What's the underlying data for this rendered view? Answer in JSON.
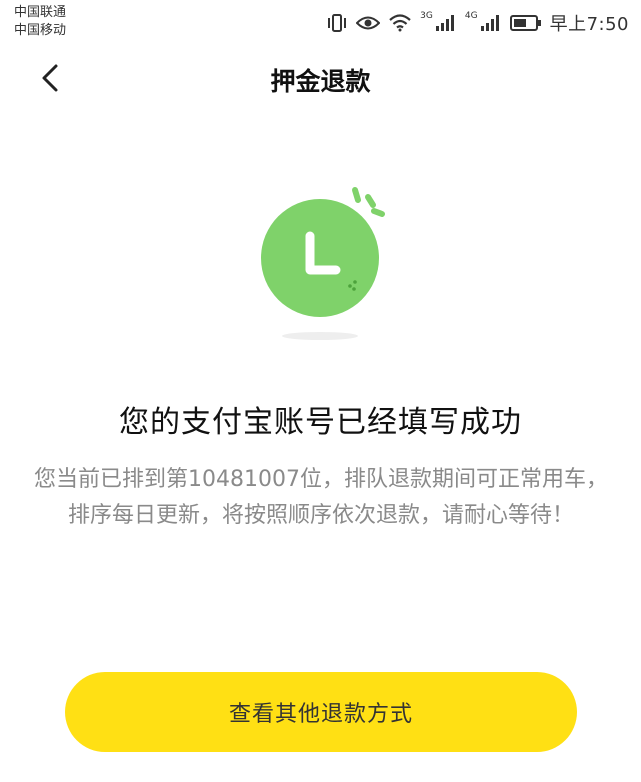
{
  "status_bar": {
    "carrier_1": "中国联通",
    "carrier_2": "中国移动",
    "net_1": "3G",
    "net_2": "4G",
    "time": "早上7:50"
  },
  "header": {
    "title": "押金退款"
  },
  "illustration": {
    "icon": "clock-icon",
    "color": "#7fd26a"
  },
  "content": {
    "success_title": "您的支付宝账号已经填写成功",
    "description": "您当前已排到第10481007位，排队退款期间可正常用车，排序每日更新，将按照顺序依次退款，请耐心等待！"
  },
  "actions": {
    "other_refund_label": "查看其他退款方式",
    "button_color": "#ffe014"
  }
}
